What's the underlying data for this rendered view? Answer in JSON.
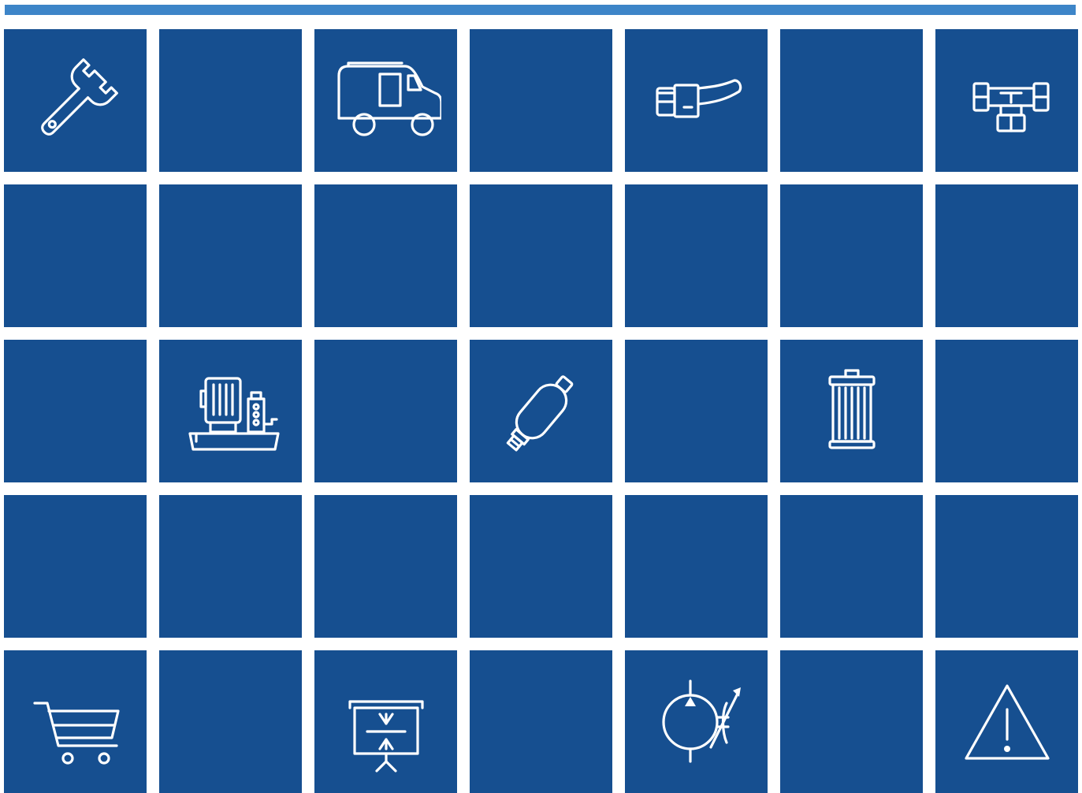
{
  "header": {
    "bar_color": "#3d85c8"
  },
  "grid": {
    "columns": 7,
    "rows": 5,
    "tile_color": "#164f90",
    "icon_color": "#ffffff",
    "tiles": [
      "wrench-icon",
      "",
      "van-icon",
      "",
      "hose-fitting-icon",
      "",
      "tee-fitting-icon",
      "",
      "",
      "",
      "",
      "",
      "",
      "",
      "",
      "pump-unit-icon",
      "",
      "accumulator-icon",
      "",
      "filter-element-icon",
      "",
      "",
      "",
      "",
      "",
      "",
      "",
      "",
      "shopping-cart-icon",
      "",
      "presentation-board-icon",
      "",
      "variable-hydraulic-motor-icon",
      "",
      "warning-icon"
    ]
  }
}
